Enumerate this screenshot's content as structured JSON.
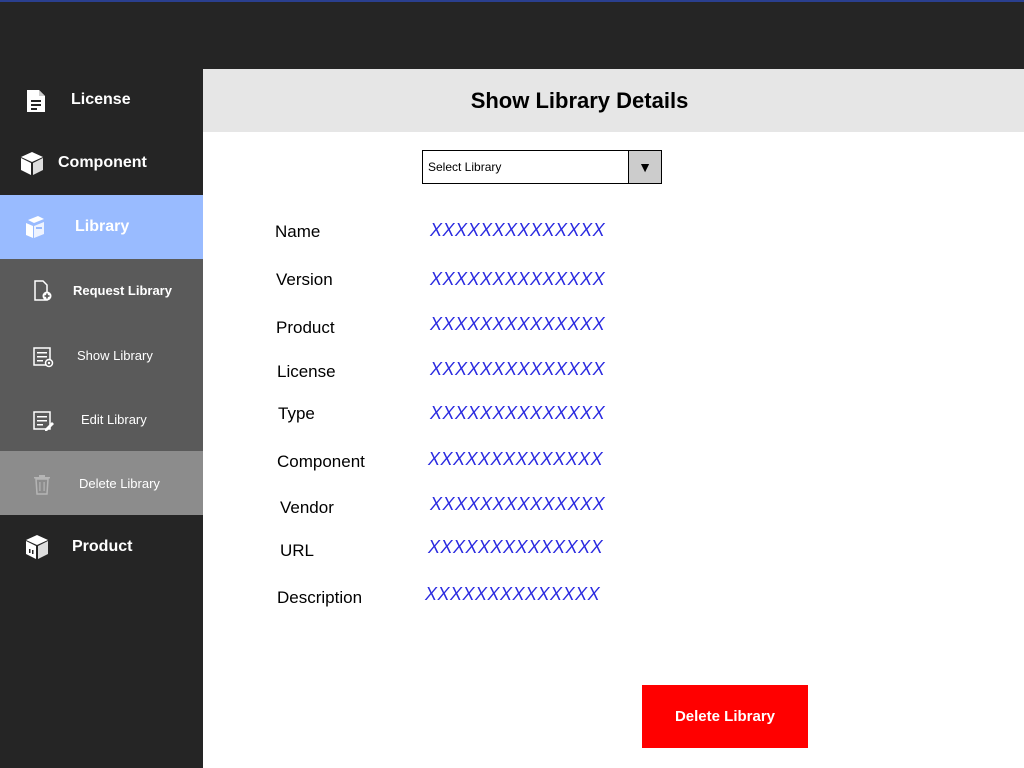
{
  "sidebar": {
    "items": [
      {
        "label": "License",
        "icon": "license-icon"
      },
      {
        "label": "Component",
        "icon": "component-icon"
      },
      {
        "label": "Library",
        "icon": "library-icon",
        "active": true
      },
      {
        "label": "Product",
        "icon": "product-icon"
      }
    ],
    "library_submenu": [
      {
        "label": "Request Library",
        "icon": "file-add-icon"
      },
      {
        "label": "Show Library",
        "icon": "list-view-icon"
      },
      {
        "label": "Edit Library",
        "icon": "list-edit-icon"
      },
      {
        "label": "Delete Library",
        "icon": "trash-icon",
        "hover": true
      }
    ]
  },
  "header": {
    "title": "Show Library Details"
  },
  "select": {
    "value": "Select Library",
    "arrow": "▼"
  },
  "fields": [
    {
      "label": "Name",
      "value": "XXXXXXXXXXXXXX"
    },
    {
      "label": "Version",
      "value": "XXXXXXXXXXXXXX"
    },
    {
      "label": "Product",
      "value": "XXXXXXXXXXXXXX"
    },
    {
      "label": "License",
      "value": "XXXXXXXXXXXXXX"
    },
    {
      "label": "Type",
      "value": "XXXXXXXXXXXXXX"
    },
    {
      "label": "Component",
      "value": "XXXXXXXXXXXXXX"
    },
    {
      "label": "Vendor",
      "value": "XXXXXXXXXXXXXX"
    },
    {
      "label": "URL",
      "value": "XXXXXXXXXXXXXX"
    },
    {
      "label": "Description",
      "value": "XXXXXXXXXXXXXX"
    }
  ],
  "actions": {
    "delete_label": "Delete Library"
  },
  "colors": {
    "sidebar_bg": "#252525",
    "active_bg": "#99bbff",
    "submenu_bg": "#5a5a5a",
    "submenu_hover_bg": "#8c8c8c",
    "header_bg": "#e6e6e6",
    "value_text": "#2a2ae0",
    "delete_button": "#ff0000"
  }
}
